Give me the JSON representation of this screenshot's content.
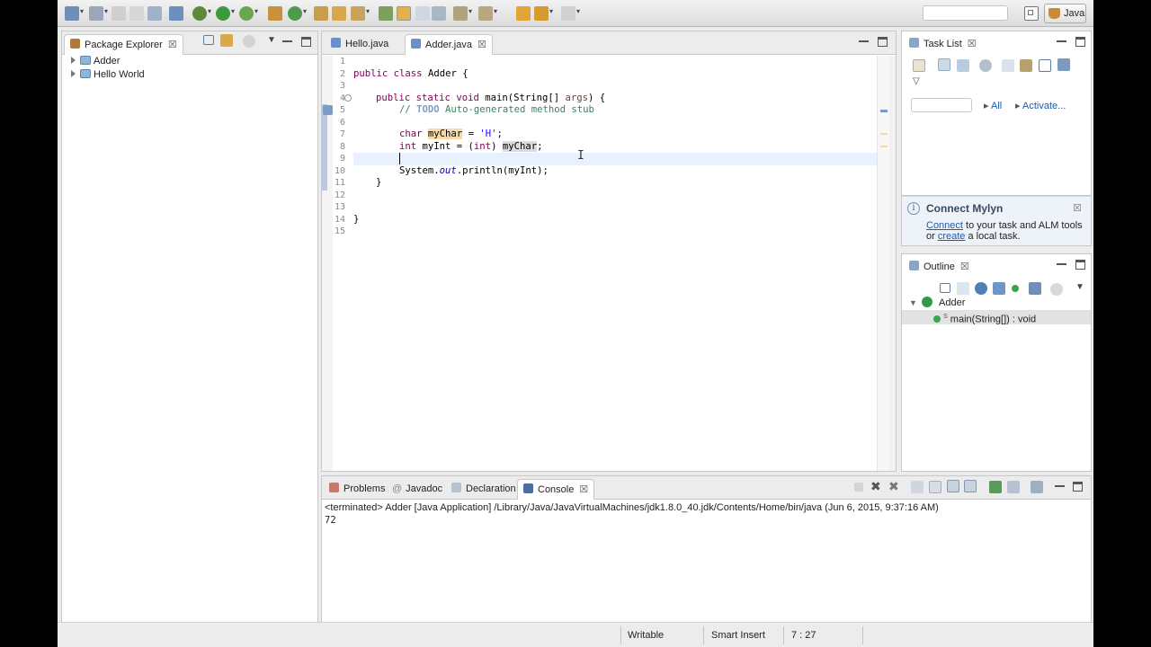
{
  "toolbar": {
    "icons": [
      "new-wizard-icon",
      "new-icon",
      "save-icon",
      "save-all-icon",
      "print-icon",
      "skip-breakpoints-icon",
      "debug-icon",
      "run-icon",
      "run-coverage-icon",
      "new-java-project-icon",
      "new-java-class-icon",
      "open-type-icon",
      "open-task-icon",
      "search-icon",
      "toggle-mark-occurrences-icon",
      "highlight-icon",
      "show-whitespace-icon",
      "block-selection-icon",
      "next-annotation-icon",
      "previous-annotation-icon",
      "back-icon",
      "forward-icon"
    ],
    "quick_access_placeholder": "",
    "perspective_label": "Java"
  },
  "package_explorer": {
    "tab_label": "Package Explorer",
    "projects": [
      {
        "label": "Adder"
      },
      {
        "label": "Hello World"
      }
    ]
  },
  "editor": {
    "tabs": [
      {
        "label": "Hello.java"
      },
      {
        "label": "Adder.java"
      }
    ],
    "active_tab": "Adder.java",
    "line_numbers": [
      "1",
      "2",
      "3",
      "4",
      "5",
      "6",
      "7",
      "8",
      "9",
      "10",
      "11",
      "12",
      "13",
      "14",
      "15"
    ],
    "code": {
      "line2": {
        "kw1": "public",
        "kw2": "class",
        "rest": " Adder {"
      },
      "line4": {
        "kw1": "public",
        "kw2": "static",
        "kw3": "void",
        "rest": " main(String[] ",
        "param": "args",
        "end": ") {"
      },
      "line5": {
        "prefix": "// ",
        "todo": "TODO",
        "rest": " Auto-generated method stub"
      },
      "line7": {
        "kw": "char",
        "var": "myChar",
        "mid": " = ",
        "str": "'H'",
        "end": ";"
      },
      "line8": {
        "kw": "int",
        "mid1": " myInt = (",
        "kw2": "int",
        "mid2": ") ",
        "var": "myChar",
        "end": ";"
      },
      "line10": {
        "start": "System.",
        "field": "out",
        "end": ".println(myInt);"
      },
      "line11": "}",
      "line14": "}"
    }
  },
  "task_list": {
    "tab_label": "Task List",
    "filter_all": "All",
    "activate": "Activate...",
    "search_placeholder": ""
  },
  "mylyn": {
    "title": "Connect Mylyn",
    "connect_link": "Connect",
    "text1": " to your task and ALM tools",
    "or": "or ",
    "create_link": "create",
    "text2": " a local task."
  },
  "outline": {
    "tab_label": "Outline",
    "class_name": "Adder",
    "method_modifier": "S",
    "method": "main(String[]) : void"
  },
  "bottom_panel": {
    "tabs": [
      {
        "label": "Problems"
      },
      {
        "label": "Javadoc"
      },
      {
        "label": "Declaration"
      },
      {
        "label": "Console"
      }
    ],
    "active_tab": "Console",
    "console": {
      "header": "<terminated> Adder [Java Application] /Library/Java/JavaVirtualMachines/jdk1.8.0_40.jdk/Contents/Home/bin/java (Jun 6, 2015, 9:37:16 AM)",
      "output": "72"
    }
  },
  "status_bar": {
    "writable": "Writable",
    "insert_mode": "Smart Insert",
    "position": "7 : 27"
  }
}
